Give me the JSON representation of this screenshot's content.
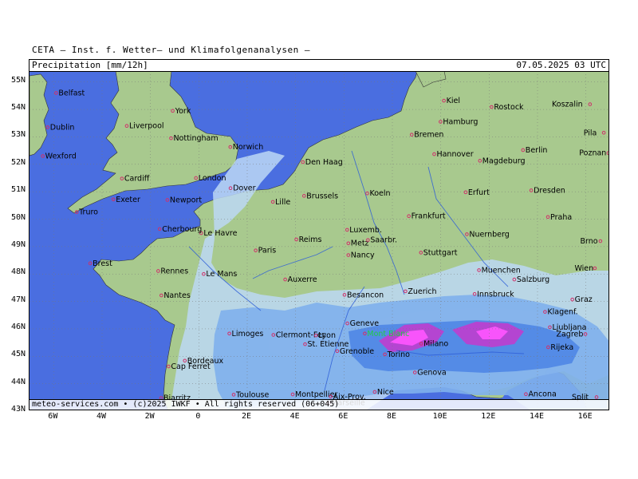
{
  "header": {
    "title": "CETA — Inst. f. Wetter— und Klimafolgenanalysen —"
  },
  "panel": {
    "parameter": "Precipitation [mm/12h]",
    "valid_time": "07.05.2025 03 UTC"
  },
  "footer": {
    "credit": "meteo-services.com • (c)2025 IWKF • All rights reserved (06+045)"
  },
  "axes": {
    "lat": [
      "55N",
      "54N",
      "53N",
      "52N",
      "51N",
      "50N",
      "49N",
      "48N",
      "47N",
      "46N",
      "45N",
      "44N",
      "43N"
    ],
    "lon": [
      "6W",
      "4W",
      "2W",
      "0",
      "2E",
      "4E",
      "6E",
      "8E",
      "10E",
      "12E",
      "14E",
      "16E"
    ]
  },
  "colors": {
    "sea": "#4a6ee0",
    "land": "#a8c98e",
    "rain_light": "#bcd8f4",
    "rain_mod": "#7fb0ec",
    "rain_heavy": "#4f86e6",
    "rain_very": "#cc33cc",
    "rain_extreme": "#ff55ff",
    "alps": "#c9b98a",
    "rivers": "#2f5fd8",
    "borders": "#333333",
    "cities": "#d0306a"
  },
  "cities": [
    {
      "name": "Belfast",
      "lat": 54.6,
      "lon": -5.9
    },
    {
      "name": "Dublin",
      "lat": 53.35,
      "lon": -6.25
    },
    {
      "name": "Wexford",
      "lat": 52.3,
      "lon": -6.45
    },
    {
      "name": "York",
      "lat": 53.95,
      "lon": -1.08
    },
    {
      "name": "Liverpool",
      "lat": 53.4,
      "lon": -2.98
    },
    {
      "name": "Nottingham",
      "lat": 52.95,
      "lon": -1.15
    },
    {
      "name": "Norwich",
      "lat": 52.63,
      "lon": 1.3
    },
    {
      "name": "Cardiff",
      "lat": 51.48,
      "lon": -3.18
    },
    {
      "name": "London",
      "lat": 51.5,
      "lon": -0.12
    },
    {
      "name": "Dover",
      "lat": 51.13,
      "lon": 1.31
    },
    {
      "name": "Exeter",
      "lat": 50.72,
      "lon": -3.53
    },
    {
      "name": "Newport",
      "lat": 50.7,
      "lon": -1.3
    },
    {
      "name": "Truro",
      "lat": 50.26,
      "lon": -5.05
    },
    {
      "name": "Den Haag",
      "lat": 52.08,
      "lon": 4.3
    },
    {
      "name": "Lille",
      "lat": 50.63,
      "lon": 3.06
    },
    {
      "name": "Brussels",
      "lat": 50.85,
      "lon": 4.35
    },
    {
      "name": "Le Havre",
      "lat": 49.49,
      "lon": 0.1
    },
    {
      "name": "Cherbourg",
      "lat": 49.64,
      "lon": -1.62
    },
    {
      "name": "Reims",
      "lat": 49.26,
      "lon": 4.03
    },
    {
      "name": "Paris",
      "lat": 48.86,
      "lon": 2.35
    },
    {
      "name": "Brest",
      "lat": 48.39,
      "lon": -4.49
    },
    {
      "name": "Rennes",
      "lat": 48.11,
      "lon": -1.68
    },
    {
      "name": "Le Mans",
      "lat": 48.0,
      "lon": 0.2
    },
    {
      "name": "Nantes",
      "lat": 47.22,
      "lon": -1.55
    },
    {
      "name": "Auxerre",
      "lat": 47.8,
      "lon": 3.57
    },
    {
      "name": "Luxemb.",
      "lat": 49.61,
      "lon": 6.13
    },
    {
      "name": "Metz",
      "lat": 49.12,
      "lon": 6.18
    },
    {
      "name": "Saarbr.",
      "lat": 49.24,
      "lon": 6.99
    },
    {
      "name": "Nancy",
      "lat": 48.69,
      "lon": 6.18
    },
    {
      "name": "Stuttgart",
      "lat": 48.78,
      "lon": 9.18
    },
    {
      "name": "Koeln",
      "lat": 50.94,
      "lon": 6.96
    },
    {
      "name": "Frankfurt",
      "lat": 50.11,
      "lon": 8.68
    },
    {
      "name": "Kiel",
      "lat": 54.32,
      "lon": 10.13
    },
    {
      "name": "Rostock",
      "lat": 54.09,
      "lon": 12.1
    },
    {
      "name": "Koszalin",
      "lat": 54.19,
      "lon": 16.17
    },
    {
      "name": "Hamburg",
      "lat": 53.55,
      "lon": 9.99
    },
    {
      "name": "Bremen",
      "lat": 53.08,
      "lon": 8.8
    },
    {
      "name": "Hannover",
      "lat": 52.37,
      "lon": 9.73
    },
    {
      "name": "Magdeburg",
      "lat": 52.13,
      "lon": 11.62
    },
    {
      "name": "Berlin",
      "lat": 52.52,
      "lon": 13.4
    },
    {
      "name": "Pila",
      "lat": 53.15,
      "lon": 16.74
    },
    {
      "name": "Poznan",
      "lat": 52.41,
      "lon": 16.93
    },
    {
      "name": "Erfurt",
      "lat": 50.98,
      "lon": 11.03
    },
    {
      "name": "Dresden",
      "lat": 51.05,
      "lon": 13.74
    },
    {
      "name": "Praha",
      "lat": 50.08,
      "lon": 14.43
    },
    {
      "name": "Nuernberg",
      "lat": 49.45,
      "lon": 11.08
    },
    {
      "name": "Brno",
      "lat": 49.2,
      "lon": 16.6
    },
    {
      "name": "Muenchen",
      "lat": 48.14,
      "lon": 11.58
    },
    {
      "name": "Salzburg",
      "lat": 47.8,
      "lon": 13.04
    },
    {
      "name": "Wien",
      "lat": 48.21,
      "lon": 16.37
    },
    {
      "name": "Zuerich",
      "lat": 47.37,
      "lon": 8.54
    },
    {
      "name": "Besancon",
      "lat": 47.24,
      "lon": 6.02
    },
    {
      "name": "Innsbruck",
      "lat": 47.27,
      "lon": 11.4
    },
    {
      "name": "Graz",
      "lat": 47.07,
      "lon": 15.44
    },
    {
      "name": "Klagenf.",
      "lat": 46.62,
      "lon": 14.31
    },
    {
      "name": "Ljubljana",
      "lat": 46.06,
      "lon": 14.51
    },
    {
      "name": "Zagreb",
      "lat": 45.81,
      "lon": 15.98
    },
    {
      "name": "Rijeka",
      "lat": 45.33,
      "lon": 14.44
    },
    {
      "name": "Limoges",
      "lat": 45.83,
      "lon": 1.26
    },
    {
      "name": "Clermont-Fer.",
      "lat": 45.78,
      "lon": 3.08
    },
    {
      "name": "Lyon",
      "lat": 45.76,
      "lon": 4.84
    },
    {
      "name": "St. Etienne",
      "lat": 45.44,
      "lon": 4.39
    },
    {
      "name": "Geneve",
      "lat": 46.2,
      "lon": 6.14
    },
    {
      "name": "Mont Blanc",
      "lat": 45.83,
      "lon": 6.86
    },
    {
      "name": "Grenoble",
      "lat": 45.19,
      "lon": 5.72
    },
    {
      "name": "Milano",
      "lat": 45.46,
      "lon": 9.19
    },
    {
      "name": "Torino",
      "lat": 45.07,
      "lon": 7.69
    },
    {
      "name": "Genova",
      "lat": 44.41,
      "lon": 8.93
    },
    {
      "name": "Bordeaux",
      "lat": 44.84,
      "lon": -0.58
    },
    {
      "name": "Cap Ferret",
      "lat": 44.63,
      "lon": -1.25
    },
    {
      "name": "Biarritz",
      "lat": 43.48,
      "lon": -1.56
    },
    {
      "name": "Toulouse",
      "lat": 43.6,
      "lon": 1.44
    },
    {
      "name": "Montpellier",
      "lat": 43.61,
      "lon": 3.88
    },
    {
      "name": "Aix-Prov.",
      "lat": 43.53,
      "lon": 5.45
    },
    {
      "name": "Nice",
      "lat": 43.7,
      "lon": 7.27
    },
    {
      "name": "Marseille",
      "lat": 43.3,
      "lon": 5.37
    },
    {
      "name": "Ancona",
      "lat": 43.62,
      "lon": 13.52
    },
    {
      "name": "Split",
      "lat": 43.51,
      "lon": 16.44
    }
  ]
}
